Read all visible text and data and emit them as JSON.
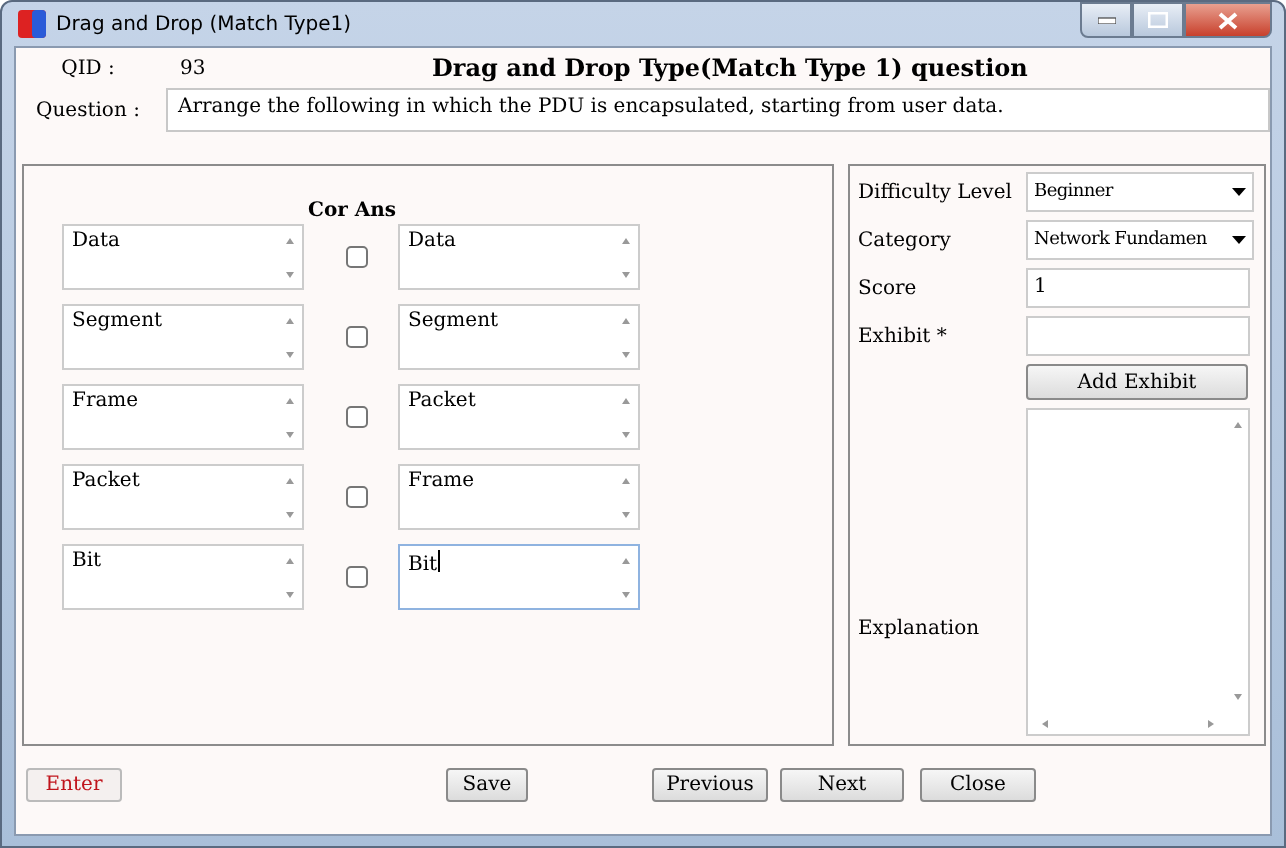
{
  "window": {
    "title": "Drag and Drop (Match Type1)"
  },
  "qid": {
    "label": "QID :",
    "value": "93"
  },
  "heading": "Drag and Drop Type(Match Type 1) question",
  "question": {
    "label": "Question :",
    "value": "Arrange the following in which the PDU is encapsulated, starting from user data."
  },
  "pairs_header": "Cor Ans",
  "pairs": [
    {
      "left": "Data",
      "right": "Data",
      "checked": false,
      "focused": false
    },
    {
      "left": "Segment",
      "right": "Segment",
      "checked": false,
      "focused": false
    },
    {
      "left": "Frame",
      "right": "Packet",
      "checked": false,
      "focused": false
    },
    {
      "left": "Packet",
      "right": "Frame",
      "checked": false,
      "focused": false
    },
    {
      "left": "Bit",
      "right": "Bit",
      "checked": false,
      "focused": true
    }
  ],
  "fields": [
    {
      "kind": "select",
      "label": "Difficulty Level",
      "value": "Beginner"
    },
    {
      "kind": "select",
      "label": "Category",
      "value": "Network Fundamen"
    },
    {
      "kind": "input",
      "label": "Score",
      "value": "1"
    },
    {
      "kind": "input",
      "label": "Exhibit *"
    }
  ],
  "add_exhibit": "Add Exhibit",
  "explanation": {
    "label": "Explanation"
  },
  "buttons": [
    {
      "label": "Enter",
      "kind": "accent"
    },
    {
      "label": "Save",
      "kind": "normal"
    },
    {
      "label": "Previous",
      "kind": "normal"
    },
    {
      "label": "Next",
      "kind": "normal"
    },
    {
      "label": "Close",
      "kind": "normal"
    }
  ]
}
